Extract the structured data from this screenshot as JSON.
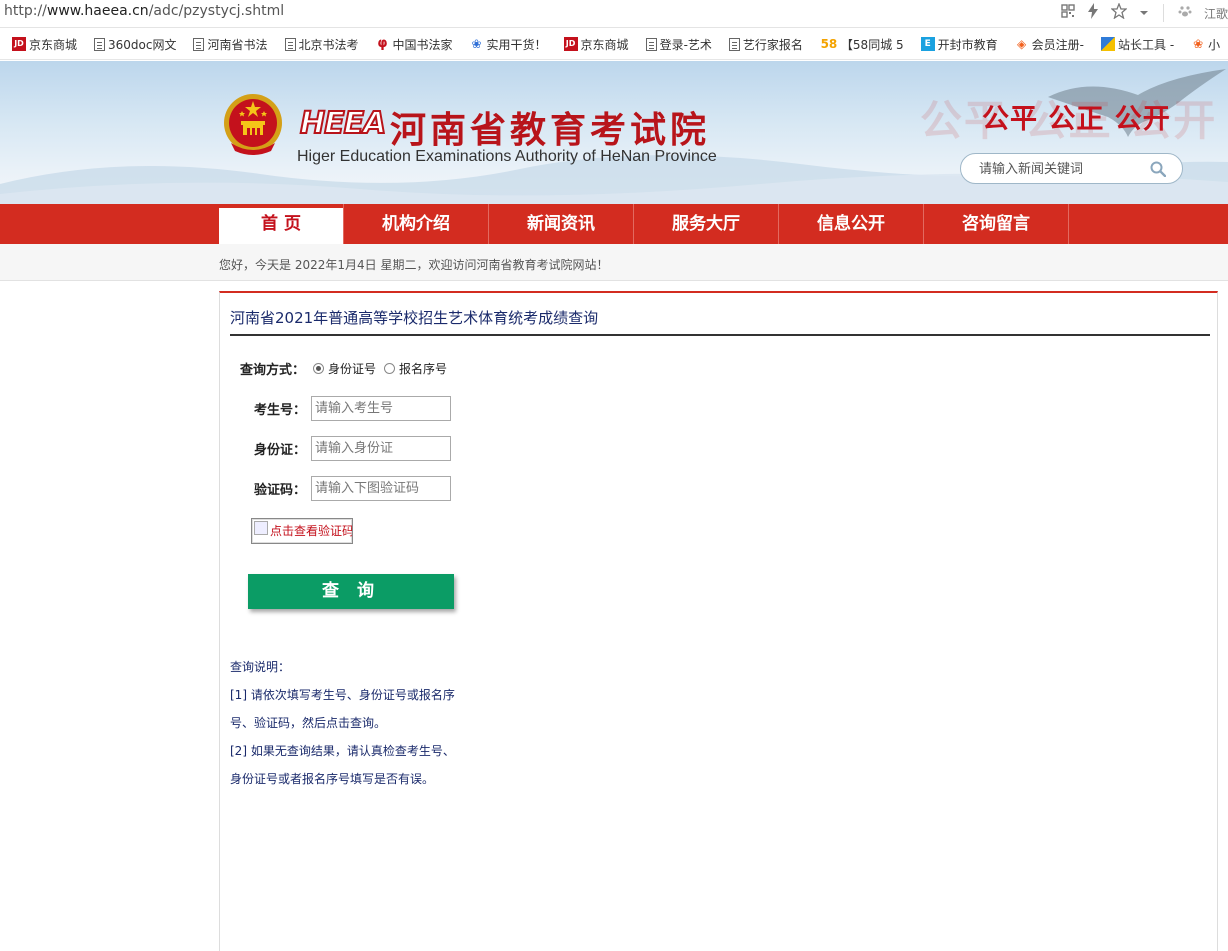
{
  "browser": {
    "url_prefix": "http://",
    "url_host": "www.haeea.cn",
    "url_path": "/adc/pzystycj.shtml",
    "user_label": "江歌",
    "bookmarks": [
      {
        "label": "京东商城",
        "icon": "jd-icon"
      },
      {
        "label": "360doc网文",
        "icon": "document-icon"
      },
      {
        "label": "河南省书法",
        "icon": "document-icon"
      },
      {
        "label": "北京书法考",
        "icon": "document-icon"
      },
      {
        "label": "中国书法家",
        "icon": "calligraphy-icon"
      },
      {
        "label": "实用干货！",
        "icon": "paw-icon"
      },
      {
        "label": "京东商城",
        "icon": "jd-icon"
      },
      {
        "label": "登录-艺术",
        "icon": "document-icon"
      },
      {
        "label": "艺行家报名",
        "icon": "document-icon"
      },
      {
        "label": "【58同城 5",
        "icon": "58-icon"
      },
      {
        "label": "开封市教育",
        "icon": "e-icon"
      },
      {
        "label": "会员注册-",
        "icon": "gem-icon"
      },
      {
        "label": "站长工具 -",
        "icon": "tool-icon"
      },
      {
        "label": "小",
        "icon": "small-icon"
      }
    ]
  },
  "header": {
    "logo_mark": "HEEA",
    "title_cn": "河南省教育考试院",
    "title_en": "Higer Education Examinations Authority of HeNan Province",
    "slogan": "公平 公正 公开",
    "slogan_bg": "公平 公正 公开",
    "search_placeholder": "请输入新闻关键词"
  },
  "nav": {
    "items": [
      "首 页",
      "机构介绍",
      "新闻资讯",
      "服务大厅",
      "信息公开",
      "咨询留言"
    ]
  },
  "greeting": "您好，今天是 2022年1月4日 星期二，欢迎访问河南省教育考试院网站！",
  "panel": {
    "title": "河南省2021年普通高等学校招生艺术体育统考成绩查询",
    "query_mode_label": "查询方式：",
    "mode_options": [
      "身份证号",
      "报名序号"
    ],
    "selected_mode": "身份证号",
    "exam_no_label": "考生号：",
    "exam_no_placeholder": "请输入考生号",
    "id_label": "身份证：",
    "id_placeholder": "请输入身份证",
    "captcha_label": "验证码：",
    "captcha_placeholder": "请输入下图验证码",
    "captcha_alt": "点击查看验证码",
    "query_button": "查 询",
    "notes": [
      "查询说明：",
      "[1] 请依次填写考生号、身份证号或报名序",
      "号、验证码，然后点击查询。",
      "[2] 如果无查询结果，请认真检查考生号、",
      "身份证号或者报名序号填写是否有误。"
    ]
  },
  "colors": {
    "nav_red": "#d32c20",
    "brand_red": "#b8141a",
    "button_green": "#0b9c65",
    "title_blue": "#1a2a6b"
  }
}
